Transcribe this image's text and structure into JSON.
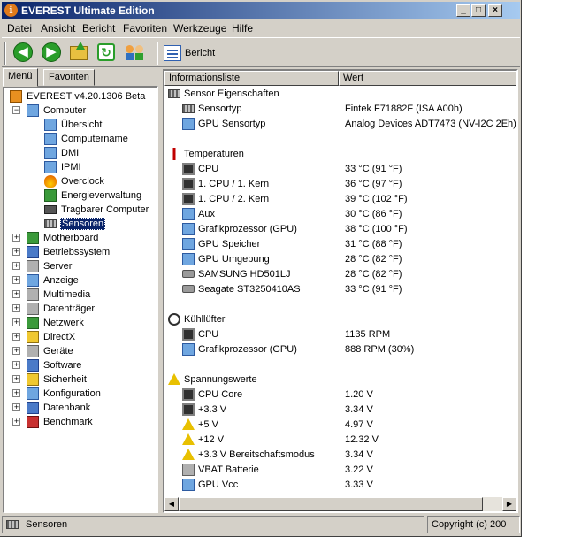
{
  "window": {
    "title": "EVEREST Ultimate Edition",
    "min_btn": "_",
    "max_btn": "□",
    "close_btn": "×"
  },
  "menu": [
    "Datei",
    "Ansicht",
    "Bericht",
    "Favoriten",
    "Werkzeuge",
    "Hilfe"
  ],
  "toolbar": {
    "report_label": "Bericht"
  },
  "tabs": {
    "menu": "Menü",
    "favorites": "Favoriten"
  },
  "tree": {
    "root": "EVEREST v4.20.1306 Beta",
    "computer": "Computer",
    "computer_children": [
      "Übersicht",
      "Computername",
      "DMI",
      "IPMI",
      "Overclock",
      "Energieverwaltung",
      "Tragbarer Computer",
      "Sensoren"
    ],
    "top_items": [
      "Motherboard",
      "Betriebssystem",
      "Server",
      "Anzeige",
      "Multimedia",
      "Datenträger",
      "Netzwerk",
      "DirectX",
      "Geräte",
      "Software",
      "Sicherheit",
      "Konfiguration",
      "Datenbank",
      "Benchmark"
    ]
  },
  "list": {
    "col_field": "Informationsliste",
    "col_value": "Wert",
    "sections": [
      {
        "title": "Sensor Eigenschaften",
        "icon": "sensor-icon",
        "rows": [
          {
            "field": "Sensortyp",
            "value": "Fintek F71882F  (ISA A00h)",
            "icon": "sensor-icon"
          },
          {
            "field": "GPU Sensortyp",
            "value": "Analog Devices ADT7473  (NV-I2C 2Eh)",
            "icon": "monitor-icon"
          }
        ]
      },
      {
        "title": "Temperaturen",
        "icon": "thermometer-icon",
        "rows": [
          {
            "field": "CPU",
            "value": "33 °C  (91 °F)",
            "icon": "cpu-icon"
          },
          {
            "field": "1. CPU / 1. Kern",
            "value": "36 °C  (97 °F)",
            "icon": "cpu-icon"
          },
          {
            "field": "1. CPU / 2. Kern",
            "value": "39 °C  (102 °F)",
            "icon": "cpu-icon"
          },
          {
            "field": "Aux",
            "value": "30 °C  (86 °F)",
            "icon": "computer-icon"
          },
          {
            "field": "Grafikprozessor (GPU)",
            "value": "38 °C  (100 °F)",
            "icon": "monitor-icon"
          },
          {
            "field": "GPU Speicher",
            "value": "31 °C  (88 °F)",
            "icon": "monitor-icon"
          },
          {
            "field": "GPU Umgebung",
            "value": "28 °C  (82 °F)",
            "icon": "monitor-icon"
          },
          {
            "field": "SAMSUNG HD501LJ",
            "value": "28 °C  (82 °F)",
            "icon": "hdd-icon"
          },
          {
            "field": "Seagate ST3250410AS",
            "value": "33 °C  (91 °F)",
            "icon": "hdd-icon"
          }
        ]
      },
      {
        "title": "Kühllüfter",
        "icon": "fan-icon",
        "rows": [
          {
            "field": "CPU",
            "value": "1135 RPM",
            "icon": "cpu-icon"
          },
          {
            "field": "Grafikprozessor (GPU)",
            "value": "888 RPM  (30%)",
            "icon": "monitor-icon"
          }
        ]
      },
      {
        "title": "Spannungswerte",
        "icon": "warning-icon",
        "rows": [
          {
            "field": "CPU Core",
            "value": "1.20 V",
            "icon": "cpu-icon"
          },
          {
            "field": "+3.3 V",
            "value": "3.34 V",
            "icon": "cpu-icon"
          },
          {
            "field": "+5 V",
            "value": "4.97 V",
            "icon": "warning-icon"
          },
          {
            "field": "+12 V",
            "value": "12.32 V",
            "icon": "warning-icon"
          },
          {
            "field": "+3.3 V Bereitschaftsmodus",
            "value": "3.34 V",
            "icon": "warning-icon"
          },
          {
            "field": "VBAT Batterie",
            "value": "3.22 V",
            "icon": "battery-icon"
          },
          {
            "field": "GPU Vcc",
            "value": "3.33 V",
            "icon": "monitor-icon"
          }
        ]
      }
    ]
  },
  "status": {
    "left": "Sensoren",
    "right": "Copyright (c) 200"
  }
}
